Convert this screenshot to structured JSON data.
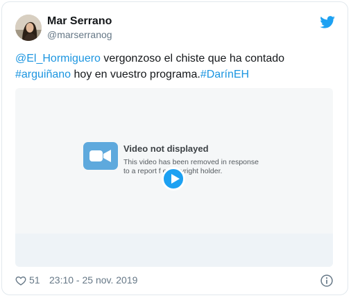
{
  "tweet": {
    "display_name": "Mar Serrano",
    "handle": "@marserranog",
    "text_parts": [
      "@El_Hormiguero",
      " vergonzoso el chiste que ha contado ",
      "#arguiñano",
      " hoy en vuestro programa.",
      "#DarínEH"
    ],
    "like_count": "51",
    "timestamp": "23:10 - 25 nov. 2019"
  },
  "media": {
    "title": "Video not displayed",
    "line1": "This video has been removed in response",
    "line2": "to a report f          e copyright holder."
  },
  "icons": {
    "avatar": "avatar",
    "logo": "twitter-bird-icon",
    "video": "video-camera-icon",
    "play": "play-icon",
    "like": "heart-icon",
    "info": "info-icon"
  },
  "colors": {
    "link": "#1b95e0",
    "brand": "#1da1f2",
    "text": "#14171a",
    "muted": "#657786"
  }
}
